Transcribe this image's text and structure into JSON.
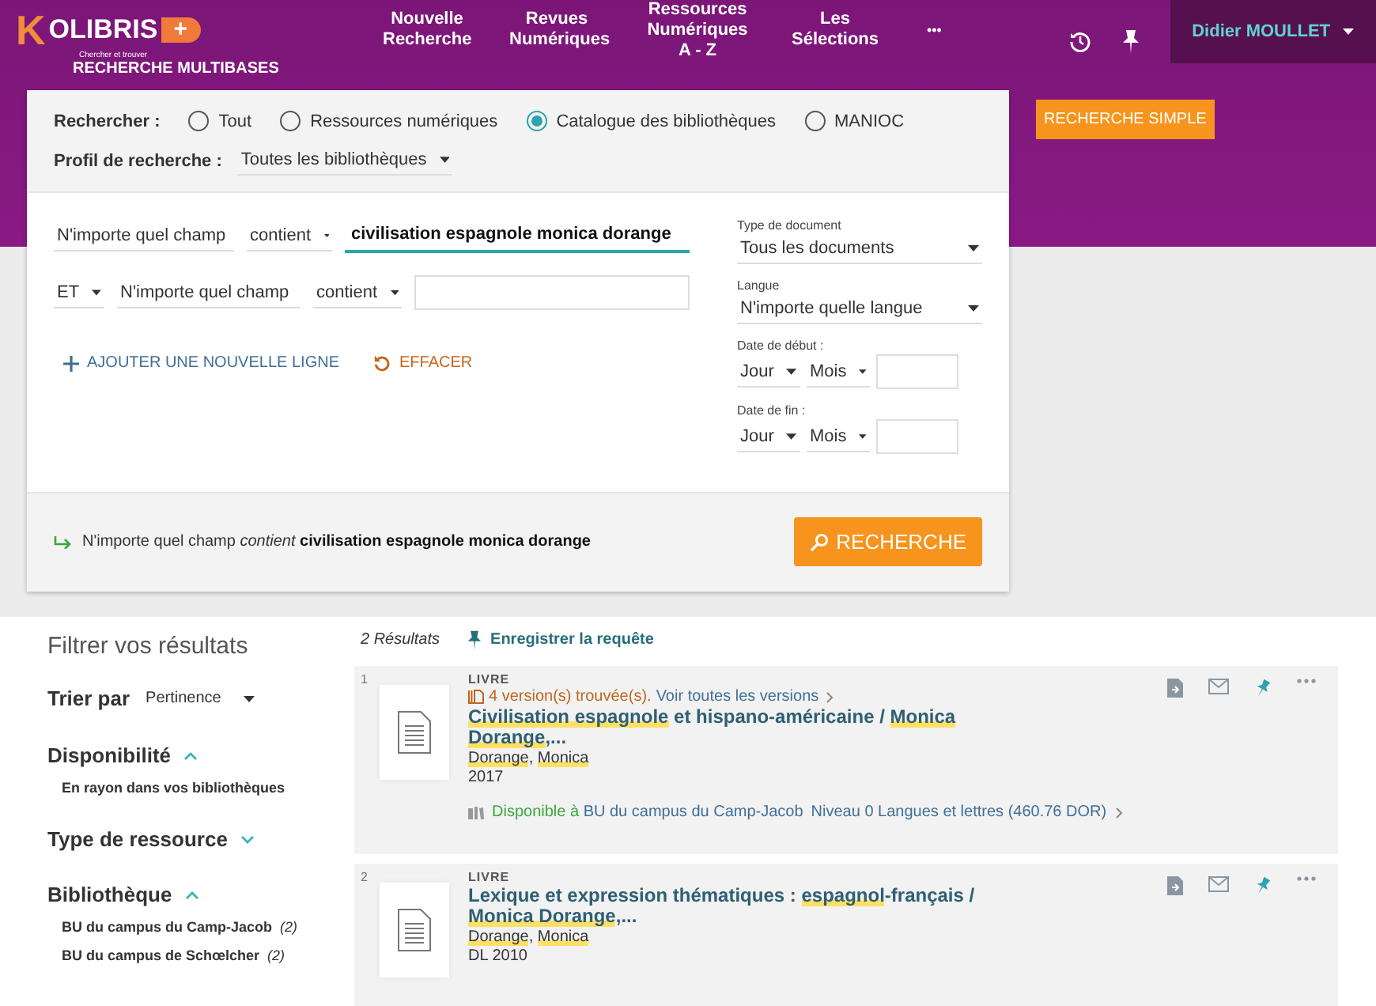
{
  "header": {
    "logo": {
      "initial": "K",
      "name": "OLIBRIS",
      "badge": "+",
      "tagline": "Chercher et trouver",
      "subtitle": "RECHERCHE MULTIBASES"
    },
    "nav": [
      {
        "label": "Nouvelle Recherche"
      },
      {
        "label": "Revues Numériques"
      },
      {
        "label": "Ressources Numériques A - Z"
      },
      {
        "label": "Les Sélections"
      }
    ],
    "more": "•••",
    "user": "Didier MOULLET"
  },
  "search": {
    "scope_label": "Rechercher :",
    "scopes": [
      {
        "label": "Tout",
        "selected": false
      },
      {
        "label": "Ressources numériques",
        "selected": false
      },
      {
        "label": "Catalogue des bibliothèques",
        "selected": true
      },
      {
        "label": "MANIOC",
        "selected": false
      }
    ],
    "profile_label": "Profil de recherche :",
    "profile": "Toutes les bibliothèques",
    "rows": [
      {
        "field": "N'importe quel champ",
        "operator": "contient",
        "value": "civilisation espagnole monica dorange",
        "focused": true
      },
      {
        "boolean": "ET",
        "field": "N'importe quel champ",
        "operator": "contient",
        "focused": false
      }
    ],
    "add_line": "AJOUTER UNE NOUVELLE LIGNE",
    "clear": "EFFACER",
    "doc_type": {
      "label": "Type de document",
      "value": "Tous les documents"
    },
    "language": {
      "label": "Langue",
      "value": "N'importe quelle langue"
    },
    "dates": [
      {
        "label": "Date de début :",
        "day": "Jour",
        "month": "Mois"
      },
      {
        "label": "Date de fin :",
        "day": "Jour",
        "month": "Mois"
      }
    ],
    "summary": {
      "field": "N'importe quel champ",
      "operator": "contient",
      "value": "civilisation espagnole monica dorange"
    },
    "submit": "RECHERCHE",
    "simple": "RECHERCHE SIMPLE"
  },
  "filters": {
    "title": "Filtrer vos résultats",
    "sort_label": "Trier par",
    "sort": "Pertinence",
    "facets": [
      {
        "title": "Disponibilité",
        "expanded": true,
        "items": [
          {
            "label": "En rayon dans vos bibliothèques"
          }
        ]
      },
      {
        "title": "Type de ressource",
        "expanded": false
      },
      {
        "title": "Bibliothèque",
        "expanded": true,
        "items": [
          {
            "label": "BU du campus du Camp-Jacob",
            "count": "(2)"
          },
          {
            "label": "BU du campus de Schœlcher",
            "count": "(2)"
          }
        ]
      }
    ]
  },
  "results": {
    "count": "2 Résultats",
    "save": "Enregistrer la requête",
    "items": [
      {
        "number": "1",
        "type": "LIVRE",
        "versions": "4 version(s) trouvée(s).",
        "versions_link": "Voir toutes les versions",
        "title": [
          {
            "text": "Civilisation espagnole",
            "highlighted": true
          },
          {
            "text": " et hispano-américaine / ",
            "highlighted": false
          },
          {
            "text": "Monica ",
            "highlighted": true
          },
          {
            "text": "Dorange",
            "highlighted": true
          },
          {
            "text": ",...",
            "highlighted": false
          }
        ],
        "author": [
          {
            "text": "Dorange",
            "highlighted": true
          },
          {
            "text": ", ",
            "highlighted": false
          },
          {
            "text": "Monica",
            "highlighted": true
          }
        ],
        "date": "2017",
        "availability": {
          "status": "Disponible à",
          "location": "BU du campus du Camp-Jacob",
          "shelf": "Niveau 0 Langues et lettres (460.76 DOR)"
        }
      },
      {
        "number": "2",
        "type": "LIVRE",
        "title": [
          {
            "text": "Lexique et expression thématiques : ",
            "highlighted": false
          },
          {
            "text": "espagnol",
            "highlighted": true
          },
          {
            "text": "-français / ",
            "highlighted": false
          },
          {
            "text": "Monica ",
            "highlighted": true
          },
          {
            "text": "Dorange",
            "highlighted": true
          },
          {
            "text": ",...",
            "highlighted": false
          }
        ],
        "author": [
          {
            "text": "Dorange",
            "highlighted": true
          },
          {
            "text": ", ",
            "highlighted": false
          },
          {
            "text": "Monica",
            "highlighted": true
          }
        ],
        "date": "DL 2010"
      }
    ]
  }
}
